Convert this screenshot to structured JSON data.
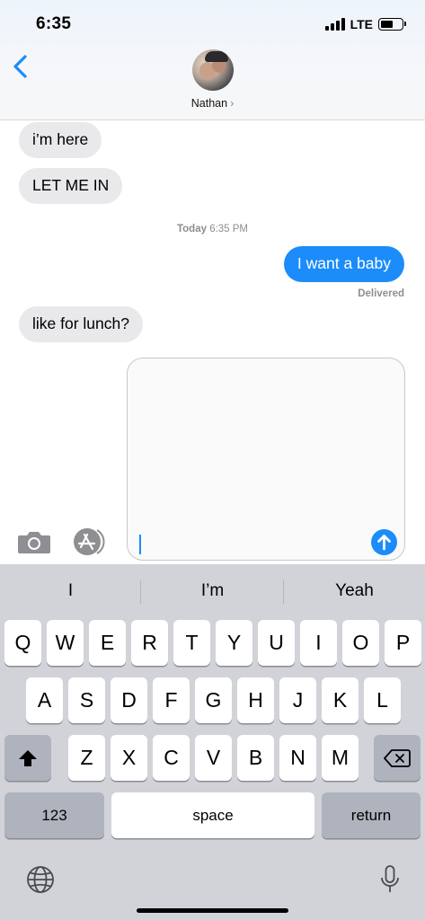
{
  "status_bar": {
    "time": "6:35",
    "network": "LTE"
  },
  "header": {
    "contact_name": "Nathan",
    "name_chevron": "›"
  },
  "messages": [
    {
      "type": "received",
      "text": "i’m here"
    },
    {
      "type": "received",
      "text": "LET ME IN"
    },
    {
      "type": "sent",
      "text": "I want a baby"
    },
    {
      "type": "received",
      "text": "like for lunch?"
    }
  ],
  "timestamp": {
    "day": "Today",
    "time": "6:35 PM"
  },
  "delivery_status": "Delivered",
  "compose": {
    "value": ""
  },
  "keyboard": {
    "predictions": [
      "I",
      "I’m",
      "Yeah"
    ],
    "row1": [
      "Q",
      "W",
      "E",
      "R",
      "T",
      "Y",
      "U",
      "I",
      "O",
      "P"
    ],
    "row2": [
      "A",
      "S",
      "D",
      "F",
      "G",
      "H",
      "J",
      "K",
      "L"
    ],
    "row3": [
      "Z",
      "X",
      "C",
      "V",
      "B",
      "N",
      "M"
    ],
    "numbers_label": "123",
    "space_label": "space",
    "return_label": "return"
  },
  "colors": {
    "accent": "#1b8cfa",
    "received_bubble": "#e9e9eb",
    "keyboard_bg": "#d1d3d9"
  },
  "icons": [
    "back-chevron-icon",
    "camera-icon",
    "app-store-icon",
    "send-arrow-icon",
    "shift-icon",
    "delete-icon",
    "globe-icon",
    "microphone-icon"
  ]
}
